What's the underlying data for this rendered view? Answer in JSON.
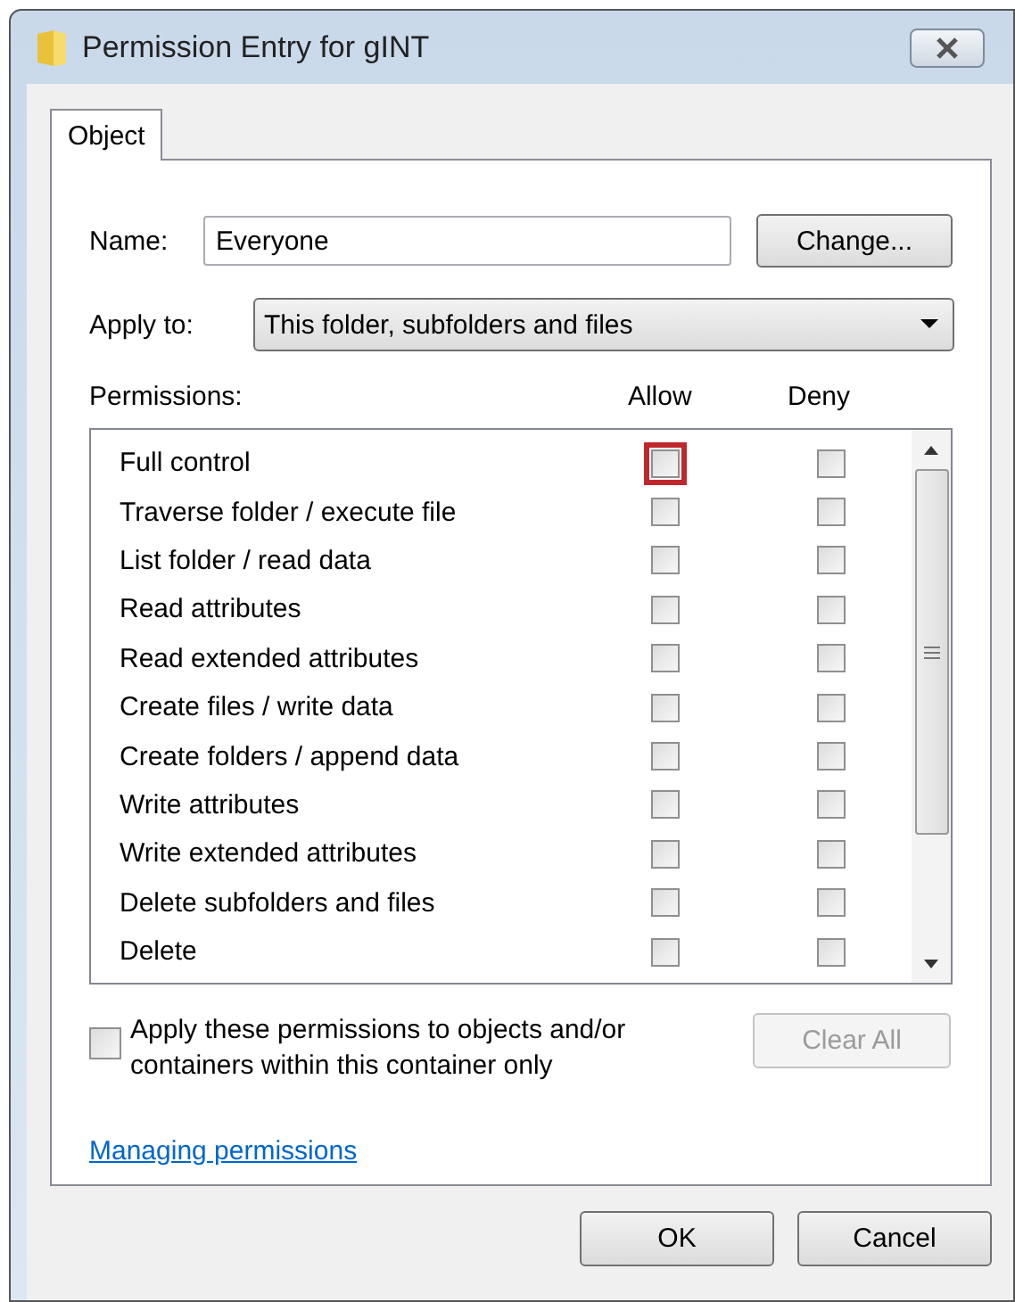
{
  "window": {
    "title": "Permission Entry for gINT"
  },
  "tabs": [
    {
      "label": "Object",
      "selected": true
    }
  ],
  "name_field": {
    "label": "Name:",
    "value": "Everyone"
  },
  "change_button": "Change...",
  "apply_to": {
    "label": "Apply to:",
    "value": "This folder, subfolders and files"
  },
  "permissions": {
    "label": "Permissions:",
    "columns": [
      "Allow",
      "Deny"
    ],
    "rows": [
      {
        "name": "Full control",
        "allow": false,
        "deny": false,
        "allow_highlighted": true
      },
      {
        "name": "Traverse folder / execute file",
        "allow": false,
        "deny": false,
        "allow_highlighted": false
      },
      {
        "name": "List folder / read data",
        "allow": false,
        "deny": false,
        "allow_highlighted": false
      },
      {
        "name": "Read attributes",
        "allow": false,
        "deny": false,
        "allow_highlighted": false
      },
      {
        "name": "Read extended attributes",
        "allow": false,
        "deny": false,
        "allow_highlighted": false
      },
      {
        "name": "Create files / write data",
        "allow": false,
        "deny": false,
        "allow_highlighted": false
      },
      {
        "name": "Create folders / append data",
        "allow": false,
        "deny": false,
        "allow_highlighted": false
      },
      {
        "name": "Write attributes",
        "allow": false,
        "deny": false,
        "allow_highlighted": false
      },
      {
        "name": "Write extended attributes",
        "allow": false,
        "deny": false,
        "allow_highlighted": false
      },
      {
        "name": "Delete subfolders and files",
        "allow": false,
        "deny": false,
        "allow_highlighted": false
      },
      {
        "name": "Delete",
        "allow": false,
        "deny": false,
        "allow_highlighted": false
      }
    ]
  },
  "apply_inherit": {
    "label": "Apply these permissions to objects and/or containers within this container only",
    "checked": false
  },
  "clear_all": {
    "label": "Clear All",
    "disabled": true
  },
  "help_link": "Managing permissions",
  "buttons": [
    "OK",
    "Cancel"
  ]
}
